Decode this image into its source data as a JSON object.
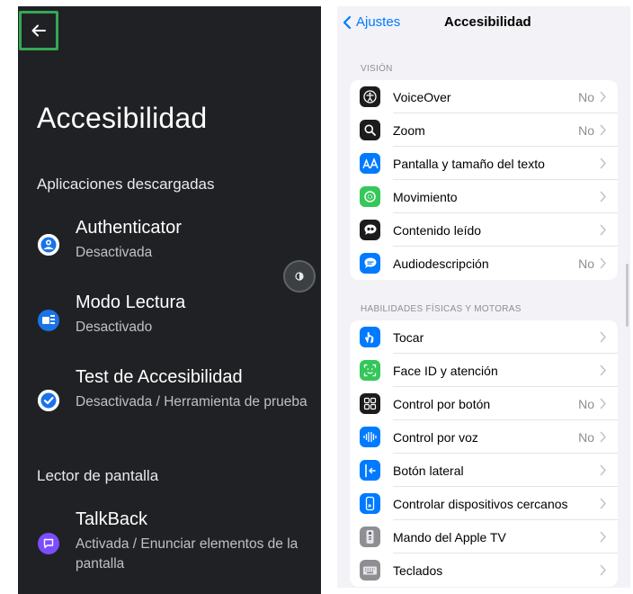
{
  "android": {
    "title": "Accesibilidad",
    "sections": [
      {
        "header": "Aplicaciones descargadas",
        "items": [
          {
            "name": "Authenticator",
            "status": "Desactivada",
            "icon": "authenticator-icon"
          },
          {
            "name": "Modo Lectura",
            "status": "Desactivado",
            "icon": "reading-mode-icon"
          },
          {
            "name": "Test de Accesibilidad",
            "status": "Desactivada / Herramienta de prueba",
            "icon": "accessibility-scanner-icon"
          }
        ]
      },
      {
        "header": "Lector de pantalla",
        "items": [
          {
            "name": "TalkBack",
            "status": "Activada / Enunciar elementos de la pantalla",
            "icon": "talkback-icon"
          }
        ]
      }
    ],
    "colors": {
      "background": "#202124",
      "back_highlight": "#34a853",
      "talkback": "#7c4dff",
      "reading": "#1a73e8"
    }
  },
  "ios": {
    "nav": {
      "back_label": "Ajustes",
      "title": "Accesibilidad"
    },
    "vision": {
      "header": "VISIÓN",
      "rows": [
        {
          "label": "VoiceOver",
          "value": "No",
          "icon": "voiceover-icon"
        },
        {
          "label": "Zoom",
          "value": "No",
          "icon": "zoom-icon"
        },
        {
          "label": "Pantalla y tamaño del texto",
          "value": "",
          "icon": "text-size-icon"
        },
        {
          "label": "Movimiento",
          "value": "",
          "icon": "motion-icon"
        },
        {
          "label": "Contenido leído",
          "value": "",
          "icon": "spoken-content-icon"
        },
        {
          "label": "Audiodescripción",
          "value": "No",
          "icon": "audio-description-icon"
        }
      ]
    },
    "physical": {
      "header": "HABILIDADES FÍSICAS Y MOTORAS",
      "rows": [
        {
          "label": "Tocar",
          "value": "",
          "icon": "touch-icon"
        },
        {
          "label": "Face ID y atención",
          "value": "",
          "icon": "face-id-icon"
        },
        {
          "label": "Control por botón",
          "value": "No",
          "icon": "switch-control-icon"
        },
        {
          "label": "Control por voz",
          "value": "No",
          "icon": "voice-control-icon"
        },
        {
          "label": "Botón lateral",
          "value": "",
          "icon": "side-button-icon"
        },
        {
          "label": "Controlar dispositivos cercanos",
          "value": "",
          "icon": "nearby-devices-icon"
        },
        {
          "label": "Mando del Apple TV",
          "value": "",
          "icon": "apple-tv-remote-icon"
        },
        {
          "label": "Teclados",
          "value": "",
          "icon": "keyboards-icon"
        }
      ]
    },
    "colors": {
      "accent": "#007aff",
      "background": "#f2f2f7"
    }
  }
}
